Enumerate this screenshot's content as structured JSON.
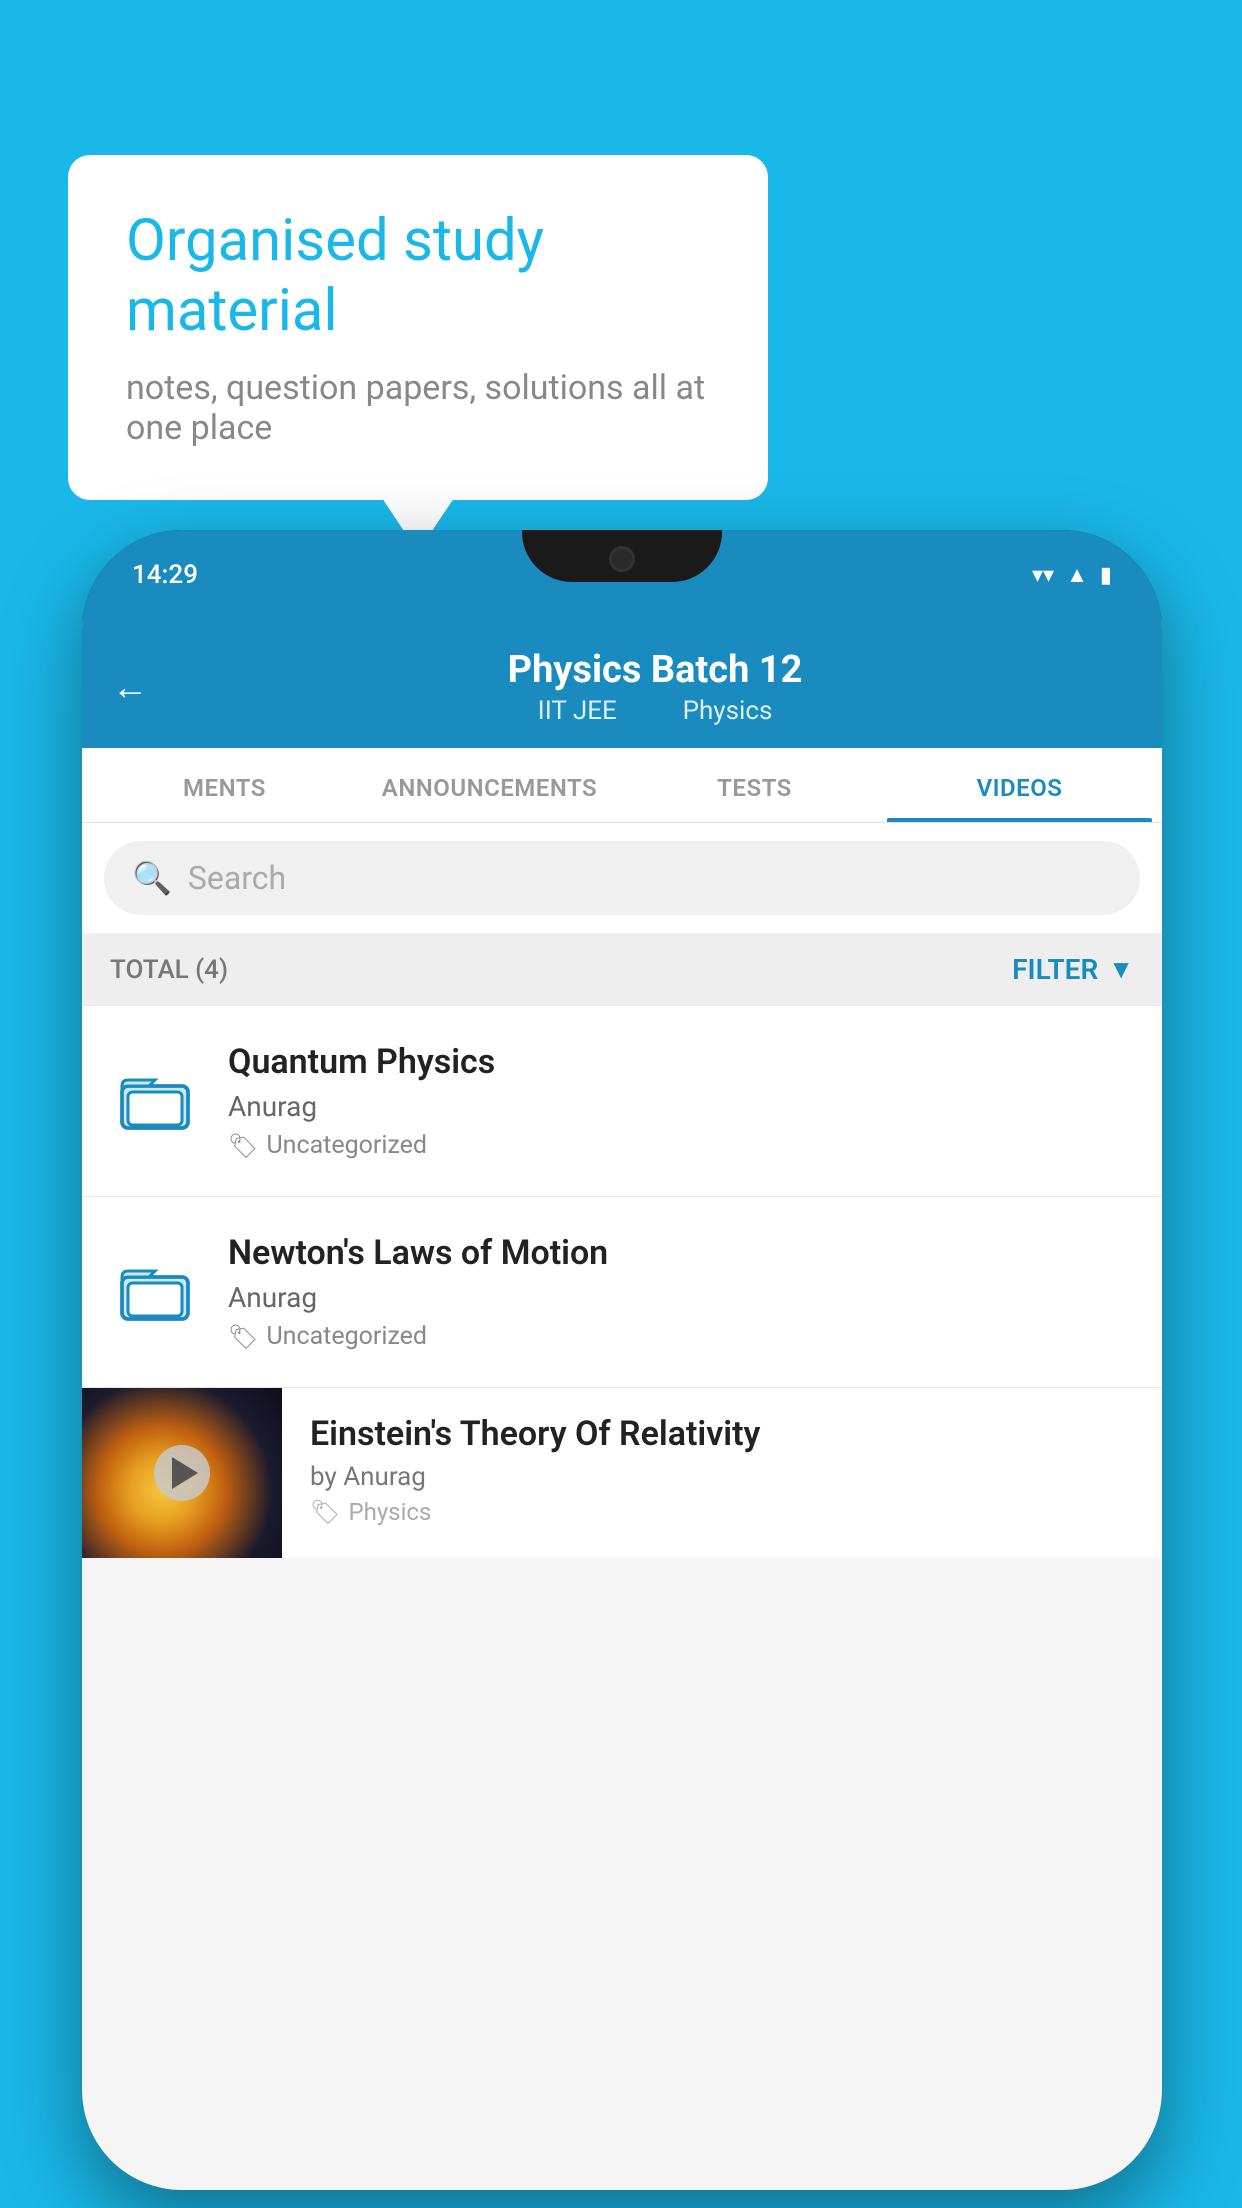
{
  "background_color": "#1ab8e8",
  "speech_bubble": {
    "title": "Organised study material",
    "subtitle": "notes, question papers, solutions all at one place"
  },
  "status_bar": {
    "time": "14:29",
    "wifi": "▼",
    "signal": "▲",
    "battery": "▮"
  },
  "app_header": {
    "back_label": "←",
    "title": "Physics Batch 12",
    "subtitle_part1": "IIT JEE",
    "subtitle_part2": "Physics"
  },
  "tabs": [
    {
      "label": "MENTS",
      "active": false
    },
    {
      "label": "ANNOUNCEMENTS",
      "active": false
    },
    {
      "label": "TESTS",
      "active": false
    },
    {
      "label": "VIDEOS",
      "active": true
    }
  ],
  "search": {
    "placeholder": "Search"
  },
  "filter_bar": {
    "total_label": "TOTAL (4)",
    "filter_label": "FILTER"
  },
  "list_items": [
    {
      "title": "Quantum Physics",
      "author": "Anurag",
      "tag": "Uncategorized",
      "type": "folder"
    },
    {
      "title": "Newton's Laws of Motion",
      "author": "Anurag",
      "tag": "Uncategorized",
      "type": "folder"
    },
    {
      "title": "Einstein's Theory Of Relativity",
      "by": "by Anurag",
      "tag": "Physics",
      "type": "video"
    }
  ]
}
